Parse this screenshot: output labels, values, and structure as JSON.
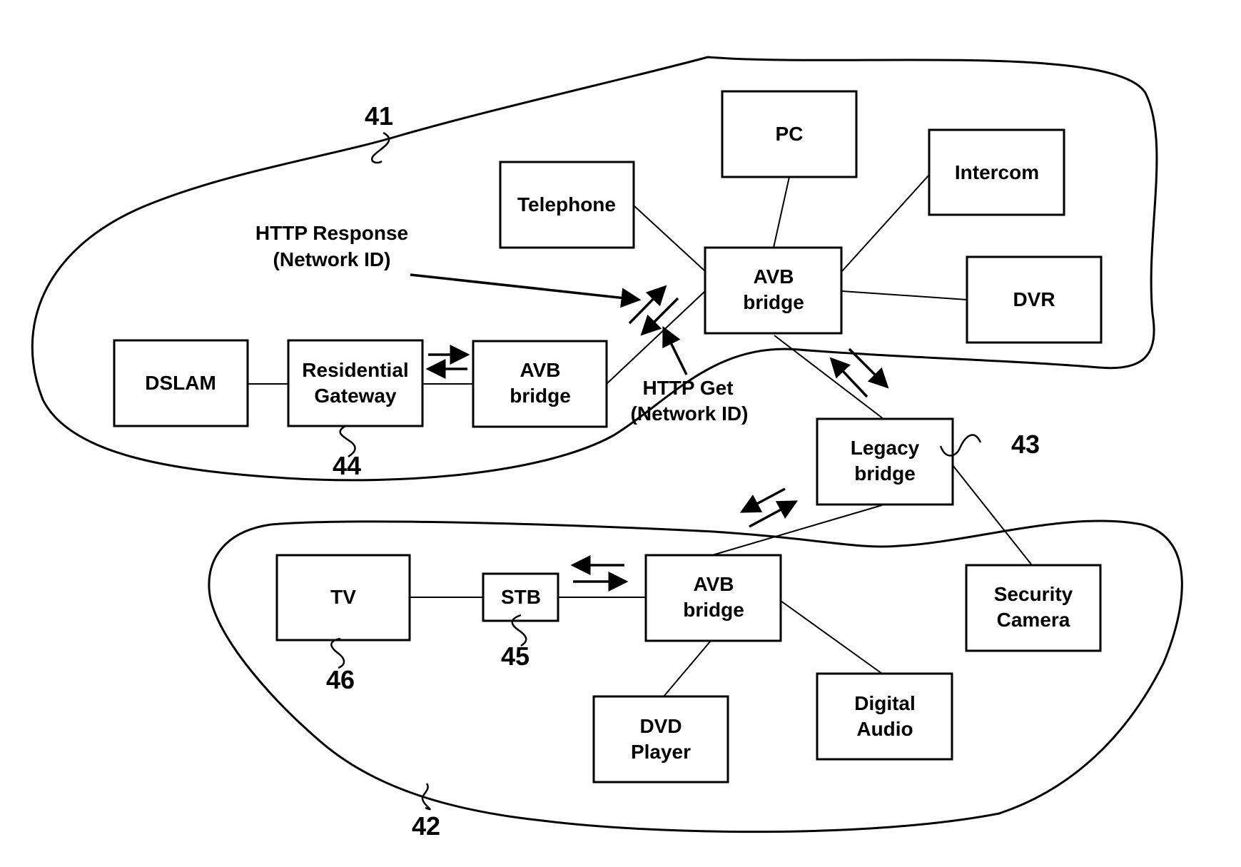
{
  "diagram": {
    "regions": [
      {
        "id": "41",
        "label": "41"
      },
      {
        "id": "42",
        "label": "42"
      }
    ],
    "nodes": {
      "telephone": {
        "lines": [
          "Telephone"
        ]
      },
      "pc": {
        "lines": [
          "PC"
        ]
      },
      "intercom": {
        "lines": [
          "Intercom"
        ]
      },
      "avb_top": {
        "lines": [
          "AVB",
          "bridge"
        ]
      },
      "dvr": {
        "lines": [
          "DVR"
        ]
      },
      "dslam": {
        "lines": [
          "DSLAM"
        ]
      },
      "gateway": {
        "lines": [
          "Residential",
          "Gateway"
        ]
      },
      "avb_left": {
        "lines": [
          "AVB",
          "bridge"
        ]
      },
      "legacy": {
        "lines": [
          "Legacy",
          "bridge"
        ]
      },
      "tv": {
        "lines": [
          "TV"
        ]
      },
      "stb": {
        "lines": [
          "STB"
        ]
      },
      "avb_bottom": {
        "lines": [
          "AVB",
          "bridge"
        ]
      },
      "security": {
        "lines": [
          "Security",
          "Camera"
        ]
      },
      "dvd": {
        "lines": [
          "DVD",
          "Player"
        ]
      },
      "audio": {
        "lines": [
          "Digital",
          "Audio"
        ]
      }
    },
    "annotations": {
      "http_response": [
        "HTTP Response",
        "(Network ID)"
      ],
      "http_get": [
        "HTTP Get",
        "(Network ID)"
      ]
    },
    "refs": {
      "r41": "41",
      "r42": "42",
      "r43": "43",
      "r44": "44",
      "r45": "45",
      "r46": "46"
    },
    "edges": [
      [
        "telephone",
        "avb_top"
      ],
      [
        "pc",
        "avb_top"
      ],
      [
        "intercom",
        "avb_top"
      ],
      [
        "dvr",
        "avb_top"
      ],
      [
        "avb_top",
        "avb_left"
      ],
      [
        "avb_top",
        "legacy"
      ],
      [
        "dslam",
        "gateway"
      ],
      [
        "gateway",
        "avb_left"
      ],
      [
        "legacy",
        "avb_bottom"
      ],
      [
        "legacy",
        "security"
      ],
      [
        "tv",
        "stb"
      ],
      [
        "stb",
        "avb_bottom"
      ],
      [
        "avb_bottom",
        "dvd"
      ],
      [
        "avb_bottom",
        "audio"
      ]
    ]
  }
}
